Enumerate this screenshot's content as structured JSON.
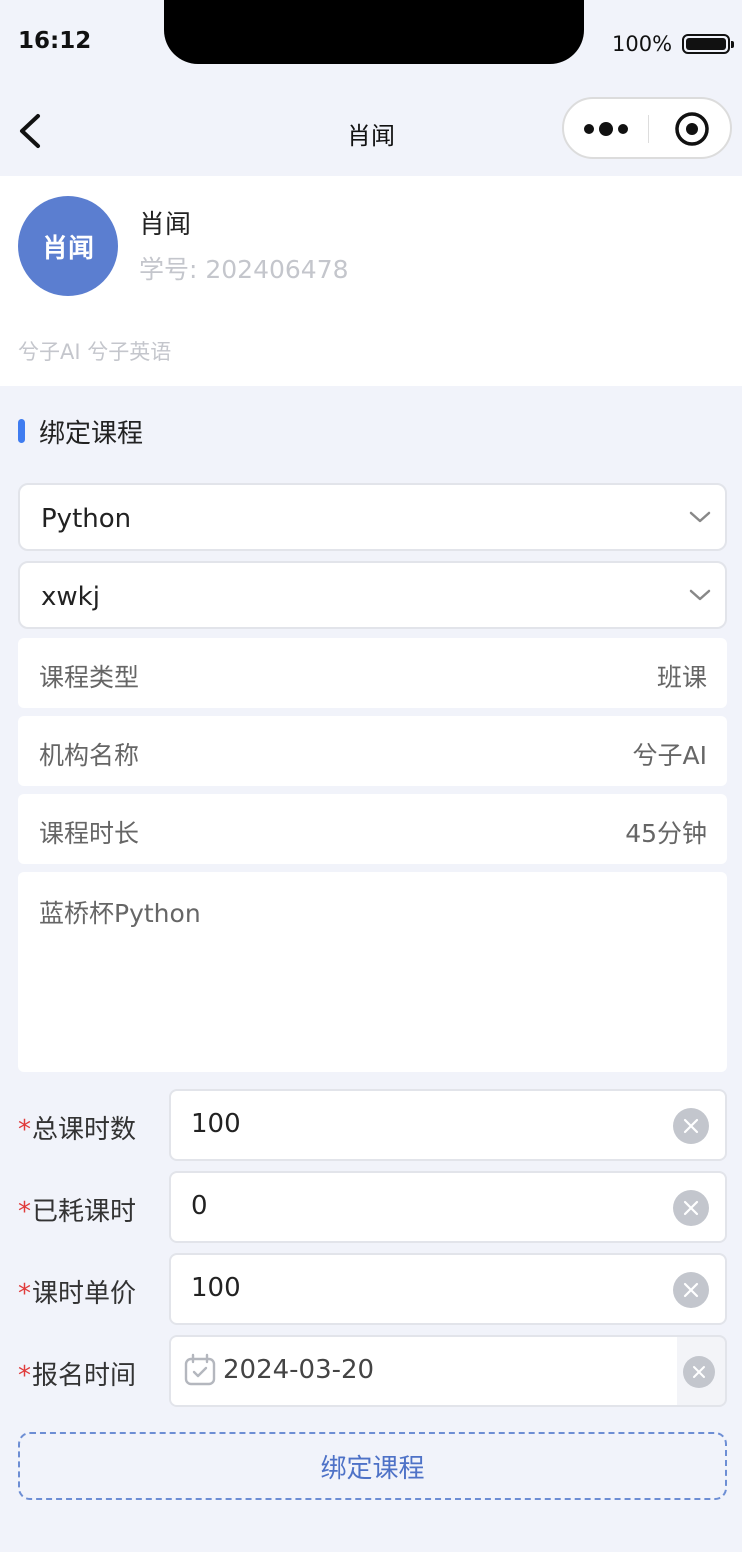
{
  "status_bar": {
    "time": "16:12",
    "battery": "100%"
  },
  "nav": {
    "title": "肖闻"
  },
  "profile": {
    "avatar_text": "肖闻",
    "name": "肖闻",
    "student_id": "学号: 202406478",
    "org": "兮子AI 兮子英语"
  },
  "section": {
    "title": "绑定课程"
  },
  "selects": [
    {
      "value": "Python"
    },
    {
      "value": "xwkj"
    }
  ],
  "info": [
    {
      "label": "课程类型",
      "value": "班课"
    },
    {
      "label": "机构名称",
      "value": "兮子AI"
    },
    {
      "label": "课程时长",
      "value": "45分钟"
    }
  ],
  "description": "蓝桥杯Python",
  "form": {
    "required_mark": "*",
    "total_hours": {
      "label": "总课时数",
      "value": "100"
    },
    "used_hours": {
      "label": "已耗课时",
      "value": "0"
    },
    "unit_price": {
      "label": "课时单价",
      "value": "100"
    },
    "enroll_date": {
      "label": "报名时间",
      "value": "2024-03-20"
    }
  },
  "submit": {
    "label": "绑定课程"
  },
  "colors": {
    "accent": "#3f7cf0",
    "avatar": "#5b7ed0",
    "required": "#e03b3b",
    "button_text": "#4e72c7"
  }
}
